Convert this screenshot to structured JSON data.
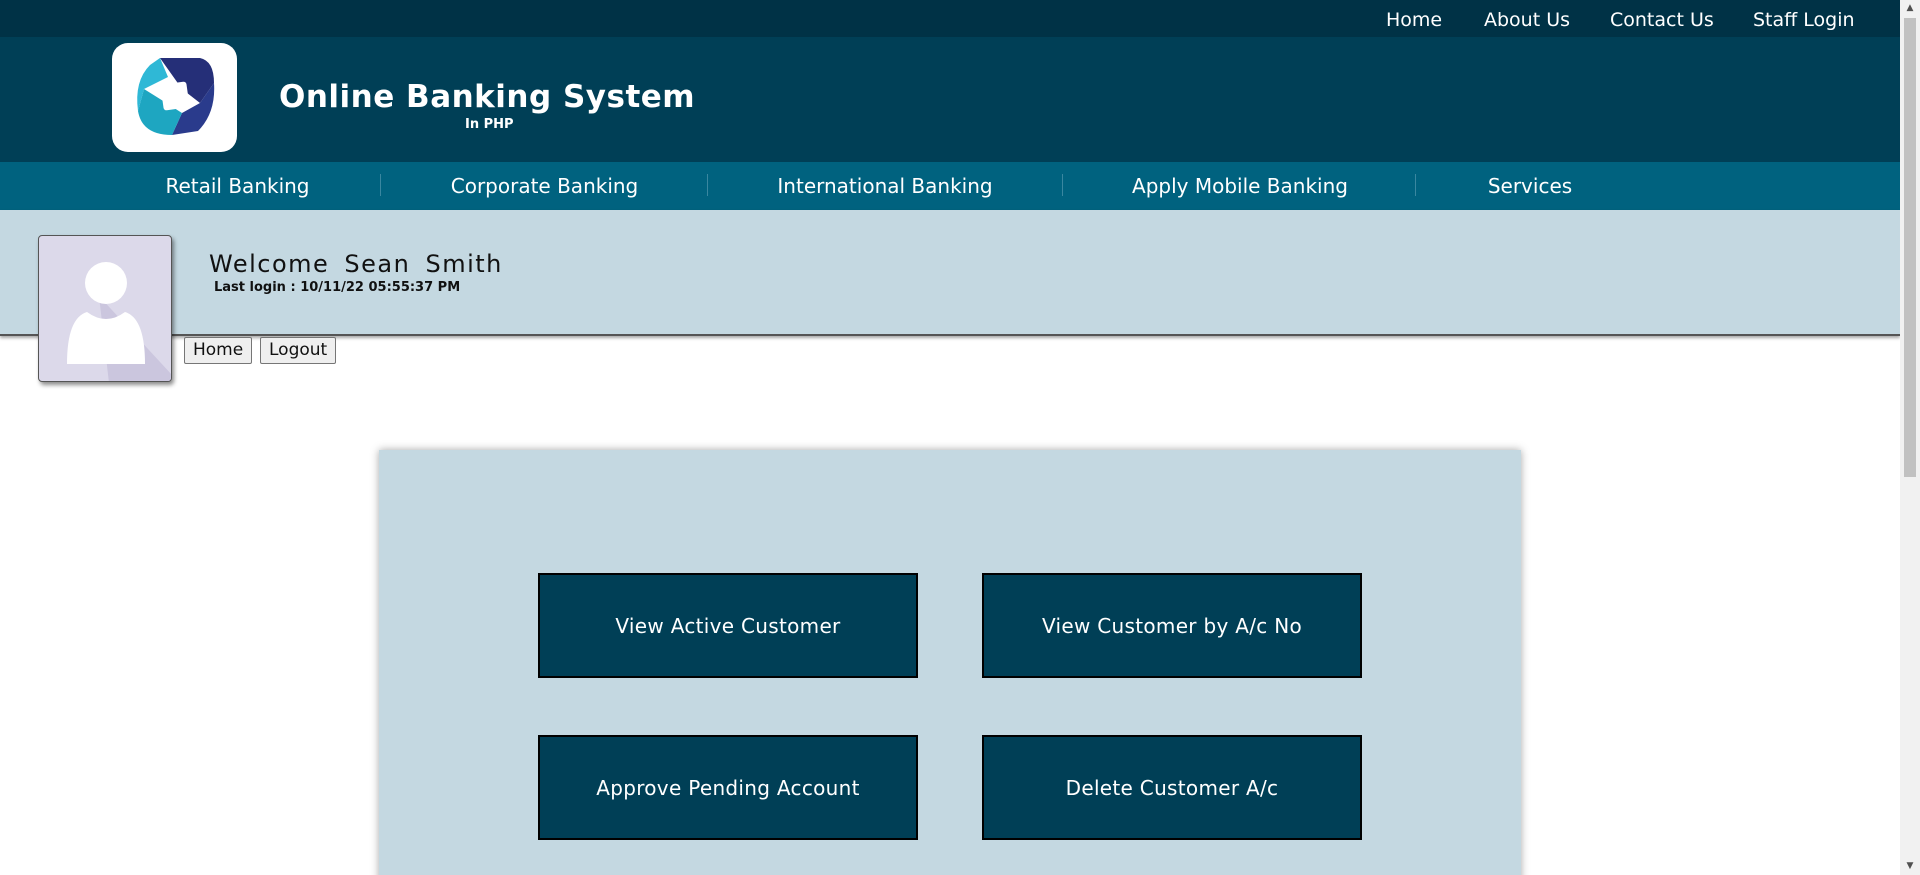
{
  "top_links": [
    "Home",
    "About Us",
    "Contact Us",
    "Staff Login"
  ],
  "header": {
    "title": "Online Banking System",
    "subtitle": "In PHP",
    "logo_icon": "bank-logo-icon"
  },
  "nav": [
    "Retail Banking",
    "Corporate Banking",
    "International Banking",
    "Apply Mobile Banking",
    "Services"
  ],
  "user": {
    "welcome": "Welcome  Sean  Smith",
    "last_login": "Last login : 10/11/22 05:55:37 PM",
    "avatar_icon": "user-avatar-icon"
  },
  "user_buttons": {
    "home": "Home",
    "logout": "Logout"
  },
  "actions": [
    "View Active Customer",
    "View Customer by A/c No",
    "Approve Pending Account",
    "Delete Customer A/c"
  ],
  "colors": {
    "topbar": "#003246",
    "header": "#003f56",
    "nav": "#00627f",
    "band": "#c4d8e1",
    "button": "#003f56"
  }
}
